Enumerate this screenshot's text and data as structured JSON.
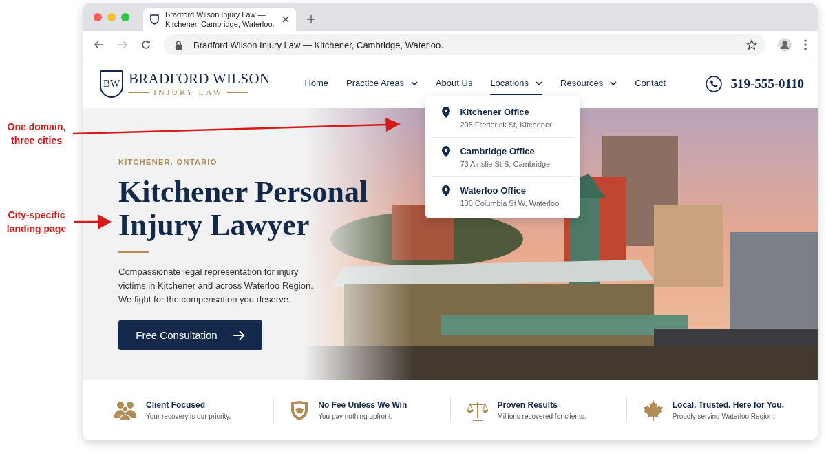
{
  "annotations": [
    {
      "lines": [
        "One domain,",
        "three cities"
      ]
    },
    {
      "lines": [
        "City-specific",
        "landing page"
      ]
    }
  ],
  "browser": {
    "tab": {
      "title": "Bradford Wilson Injury Law — Kitchener, Cambridge, Waterloo.",
      "selected": true
    },
    "url": "Bradford Wilson Injury Law — Kitchener, Cambridge, Waterloo."
  },
  "header": {
    "logo": {
      "monogram": "BW",
      "name": "BRADFORD WILSON",
      "tagline": "INJURY LAW"
    },
    "nav": [
      {
        "label": "Home",
        "dropdown": false,
        "selected": false
      },
      {
        "label": "Practice Areas",
        "dropdown": true,
        "selected": false
      },
      {
        "label": "About Us",
        "dropdown": false,
        "selected": false
      },
      {
        "label": "Locations",
        "dropdown": true,
        "selected": true
      },
      {
        "label": "Resources",
        "dropdown": true,
        "selected": false
      },
      {
        "label": "Contact",
        "dropdown": false,
        "selected": false
      }
    ],
    "phone": "519-555-0110"
  },
  "locations_menu": [
    {
      "title": "Kitchener Office",
      "address": "205 Frederick St, Kitchener"
    },
    {
      "title": "Cambridge Office",
      "address": "73 Ainslie St S, Cambridge"
    },
    {
      "title": "Waterloo Office",
      "address": "130 Columbia St W, Waterloo"
    }
  ],
  "hero": {
    "eyebrow": "KITCHENER, ONTARIO",
    "heading": "Kitchener Personal Injury Lawyer",
    "text": "Compassionate legal representation for injury victims in Kitchener and across Waterloo Region. We fight for the compensation you deserve.",
    "button": "Free Consultation"
  },
  "features": [
    {
      "kind": "people",
      "title": "Client Focused",
      "text": "Your recovery is our priority."
    },
    {
      "kind": "shield",
      "title": "No Fee Unless We Win",
      "text": "You pay nothing upfront."
    },
    {
      "kind": "scales",
      "title": "Proven Results",
      "text": "Millions recovered for clients."
    },
    {
      "kind": "leaf",
      "title": "Local. Trusted. Here for You.",
      "text": "Proudly serving Waterloo Region."
    }
  ]
}
